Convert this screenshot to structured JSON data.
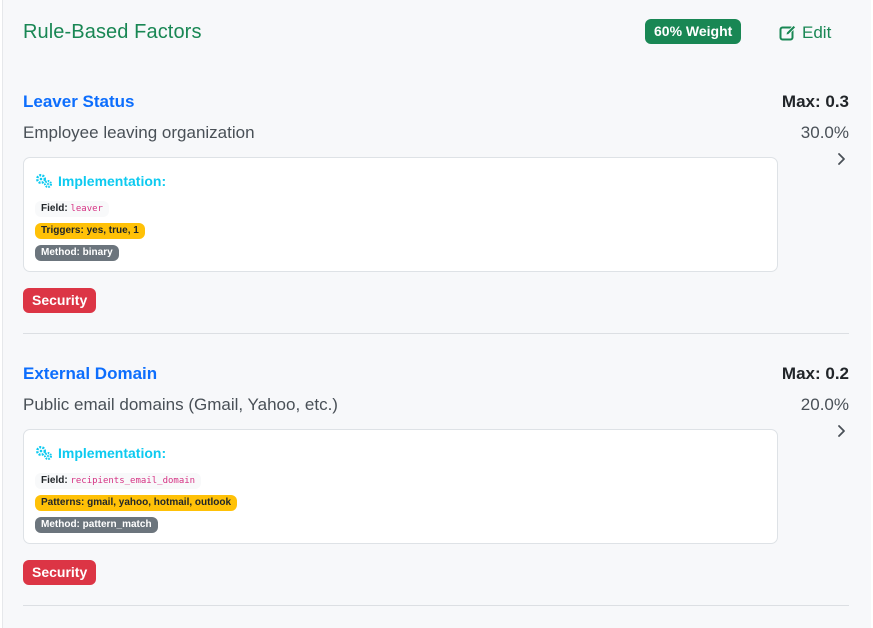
{
  "header": {
    "title": "Rule-Based Factors",
    "weight_badge": "60% Weight",
    "edit_label": "Edit"
  },
  "factors": [
    {
      "name": "Leaver Status",
      "max": "Max: 0.3",
      "description": "Employee leaving organization",
      "percent": "30.0%",
      "implementation_title": "Implementation:",
      "field_label": "Field:",
      "field_value": "leaver",
      "match_label": "Triggers: yes, true, 1",
      "method_label": "Method: binary",
      "category": "Security"
    },
    {
      "name": "External Domain",
      "max": "Max: 0.2",
      "description": "Public email domains (Gmail, Yahoo, etc.)",
      "percent": "20.0%",
      "implementation_title": "Implementation:",
      "field_label": "Field:",
      "field_value": "recipients_email_domain",
      "match_label": "Patterns: gmail, yahoo, hotmail, outlook",
      "method_label": "Method: pattern_match",
      "category": "Security"
    }
  ],
  "colors": {
    "success": "#198754",
    "primary": "#0d6efd",
    "info": "#0dcaf0",
    "warning": "#ffc107",
    "secondary": "#6c757d",
    "danger": "#dc3545"
  },
  "icons": {
    "edit": "pen-to-square-icon",
    "implementation": "gears-icon",
    "expand": "chevron-right-icon"
  }
}
